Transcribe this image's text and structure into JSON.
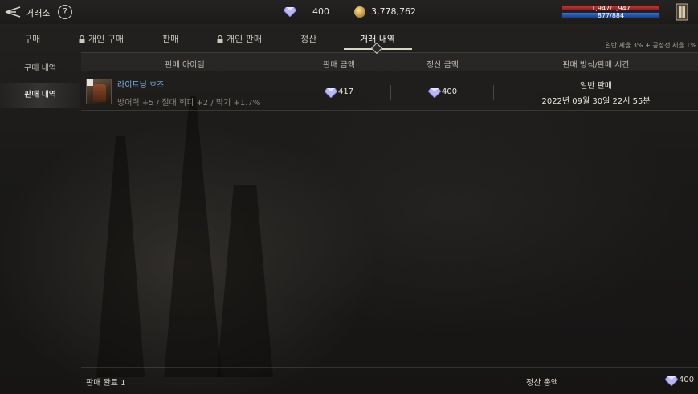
{
  "header": {
    "title": "거래소",
    "help_glyph": "?",
    "diamond_amount": "400",
    "gold_amount": "3,778,762",
    "hp_text": "1,947/1,947",
    "mp_text": "877/884"
  },
  "tabs": [
    {
      "label": "구매",
      "locked": false,
      "active": false
    },
    {
      "label": "개인 구매",
      "locked": true,
      "active": false
    },
    {
      "label": "판매",
      "locked": false,
      "active": false
    },
    {
      "label": "개인 판매",
      "locked": true,
      "active": false
    },
    {
      "label": "정산",
      "locked": false,
      "active": false
    },
    {
      "label": "거래 내역",
      "locked": false,
      "active": true
    }
  ],
  "tax_note": "일반 세율 3% + 공성전 세율 1%",
  "sidebar": {
    "items": [
      {
        "label": "구매 내역",
        "active": false
      },
      {
        "label": "판매 내역",
        "active": true
      }
    ]
  },
  "table": {
    "headers": [
      "판매 아이템",
      "판매 금액",
      "정산 금액",
      "판매 방식/판매 시간"
    ],
    "rows": [
      {
        "item_name": "라이트닝 호즈",
        "item_stats": "방어력 +5 / 절대 회피 +2 / 막기 +1.7%",
        "sale_price": "417",
        "settle_price": "400",
        "method": "일반 판매",
        "time": "2022년 09월 30일 22시 55분"
      }
    ]
  },
  "footer": {
    "completed": "판매 완료 1",
    "total_label": "정산 총액",
    "total_value": "400"
  },
  "colors": {
    "item_name": "#7db2e8",
    "hp_bar": "#c04040",
    "mp_bar": "#3a72c8"
  }
}
